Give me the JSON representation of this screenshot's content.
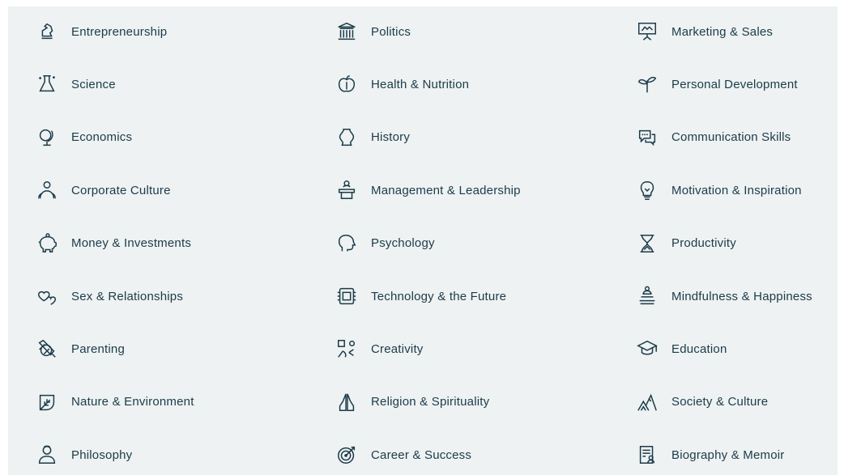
{
  "categories": [
    {
      "label": "Entrepreneurship",
      "icon": "chess-knight-icon"
    },
    {
      "label": "Politics",
      "icon": "capitol-building-icon"
    },
    {
      "label": "Marketing & Sales",
      "icon": "presentation-board-icon"
    },
    {
      "label": "Science",
      "icon": "flask-icon"
    },
    {
      "label": "Health & Nutrition",
      "icon": "apple-icon"
    },
    {
      "label": "Personal Development",
      "icon": "plant-sprout-icon"
    },
    {
      "label": "Economics",
      "icon": "globe-stand-icon"
    },
    {
      "label": "History",
      "icon": "vase-icon"
    },
    {
      "label": "Communication Skills",
      "icon": "speech-bubbles-icon"
    },
    {
      "label": "Corporate Culture",
      "icon": "people-group-icon"
    },
    {
      "label": "Management & Leadership",
      "icon": "podium-speaker-icon"
    },
    {
      "label": "Motivation & Inspiration",
      "icon": "lightbulb-icon"
    },
    {
      "label": "Money & Investments",
      "icon": "piggy-bank-icon"
    },
    {
      "label": "Psychology",
      "icon": "head-profile-icon"
    },
    {
      "label": "Productivity",
      "icon": "hourglass-icon"
    },
    {
      "label": "Sex & Relationships",
      "icon": "hearts-icon"
    },
    {
      "label": "Technology & the Future",
      "icon": "microchip-icon"
    },
    {
      "label": "Mindfulness & Happiness",
      "icon": "meditation-stones-icon"
    },
    {
      "label": "Parenting",
      "icon": "baby-bottle-icon"
    },
    {
      "label": "Creativity",
      "icon": "shapes-icon"
    },
    {
      "label": "Education",
      "icon": "graduation-cap-icon"
    },
    {
      "label": "Nature & Environment",
      "icon": "leaf-icon"
    },
    {
      "label": "Religion & Spirituality",
      "icon": "praying-hands-icon"
    },
    {
      "label": "Society & Culture",
      "icon": "tents-icon"
    },
    {
      "label": "Philosophy",
      "icon": "thinker-bust-icon"
    },
    {
      "label": "Career & Success",
      "icon": "target-icon"
    },
    {
      "label": "Biography & Memoir",
      "icon": "document-person-icon"
    }
  ],
  "colors": {
    "background": "#eef2f2",
    "text": "#1c3b4a"
  }
}
